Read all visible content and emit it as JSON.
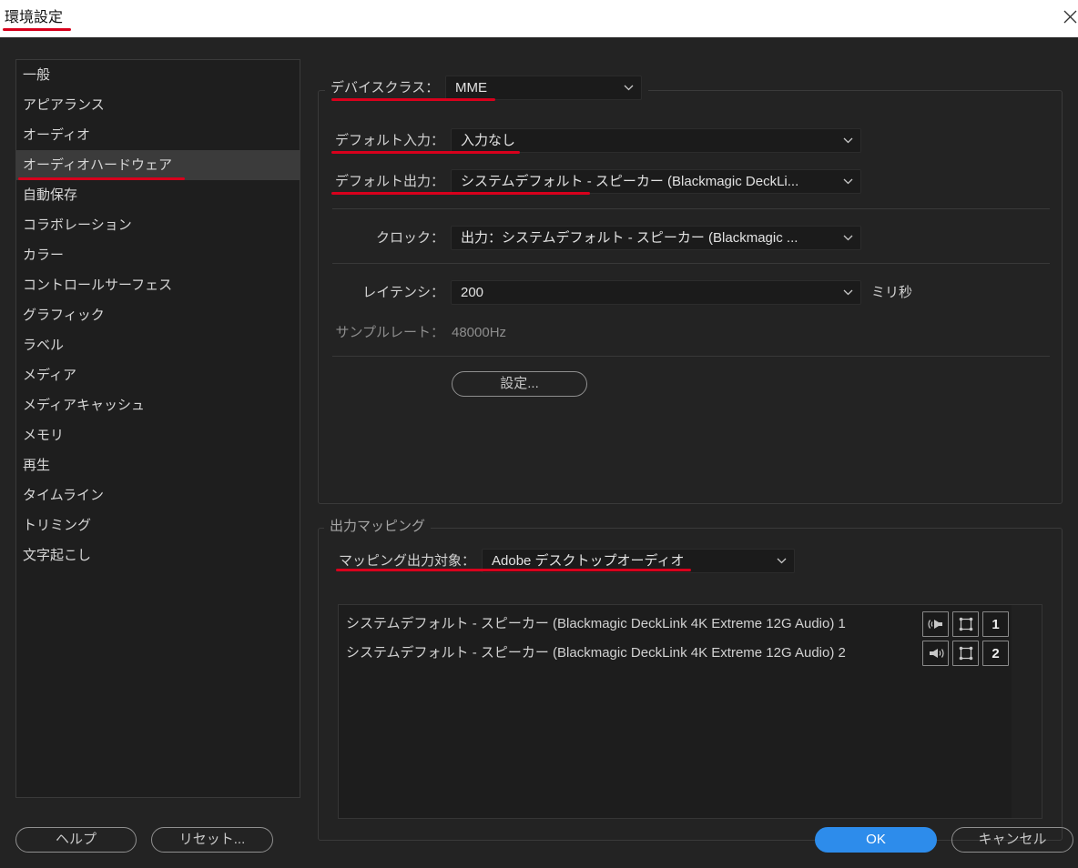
{
  "window": {
    "title": "環境設定"
  },
  "icons": {
    "close": "close-icon",
    "dropdown": "chevron-down-icon"
  },
  "colors": {
    "background": "#232323",
    "accent": "#2d8ceb",
    "annotation": "#d8001c",
    "selected_item": "#3b3b3b"
  },
  "sidebar": {
    "items": [
      {
        "label": "一般"
      },
      {
        "label": "アピアランス"
      },
      {
        "label": "オーディオ"
      },
      {
        "label": "オーディオハードウェア",
        "selected": true
      },
      {
        "label": "自動保存"
      },
      {
        "label": "コラボレーション"
      },
      {
        "label": "カラー"
      },
      {
        "label": "コントロールサーフェス"
      },
      {
        "label": "グラフィック"
      },
      {
        "label": "ラベル"
      },
      {
        "label": "メディア"
      },
      {
        "label": "メディアキャッシュ"
      },
      {
        "label": "メモリ"
      },
      {
        "label": "再生"
      },
      {
        "label": "タイムライン"
      },
      {
        "label": "トリミング"
      },
      {
        "label": "文字起こし"
      }
    ]
  },
  "audio_hardware": {
    "device_class": {
      "label": "デバイスクラス：",
      "value": "MME"
    },
    "default_input": {
      "label": "デフォルト入力：",
      "value": "入力なし"
    },
    "default_output": {
      "label": "デフォルト出力：",
      "value": "システムデフォルト - スピーカー (Blackmagic DeckLi..."
    },
    "clock": {
      "label": "クロック：",
      "value": "出力：システムデフォルト - スピーカー (Blackmagic ..."
    },
    "latency": {
      "label": "レイテンシ：",
      "value": "200",
      "unit": "ミリ秒"
    },
    "sample_rate": {
      "label": "サンプルレート：",
      "value": "48000Hz"
    },
    "settings_button": "設定..."
  },
  "output_mapping": {
    "title": "出力マッピング",
    "target": {
      "label": "マッピング出力対象：",
      "value": "Adobe デスクトップオーディオ"
    },
    "channels": [
      {
        "name": "システムデフォルト - スピーカー (Blackmagic DeckLink 4K Extreme 12G Audio) 1",
        "speaker_icon": "speaker-left-icon",
        "frame_icon": "frame-icon",
        "number": "1"
      },
      {
        "name": "システムデフォルト - スピーカー (Blackmagic DeckLink 4K Extreme 12G Audio) 2",
        "speaker_icon": "speaker-right-icon",
        "frame_icon": "frame-icon",
        "number": "2"
      }
    ]
  },
  "footer": {
    "help": "ヘルプ",
    "reset": "リセット...",
    "ok": "OK",
    "cancel": "キャンセル"
  }
}
